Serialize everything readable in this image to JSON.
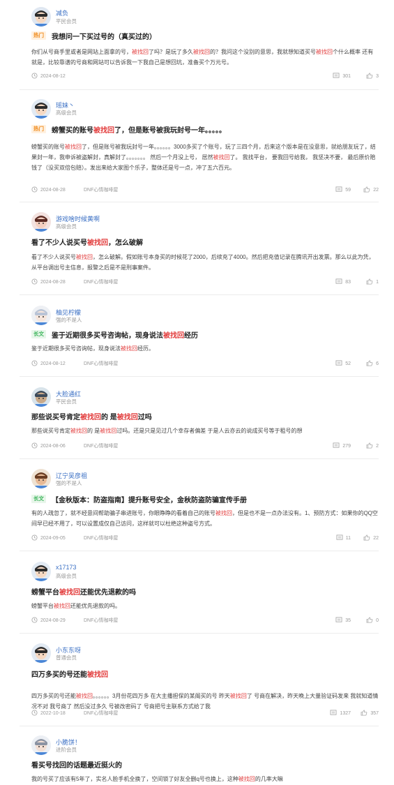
{
  "posts": [
    {
      "user": "减负",
      "level": "平民会员",
      "tag": "热门",
      "tag_type": "hot",
      "title_parts": [
        {
          "t": "我想问一下买过号的（真买过的）"
        }
      ],
      "body_parts": [
        {
          "t": "你们从号商手里或者是网站上面拿的号，"
        },
        {
          "t": "被找回",
          "hl": true
        },
        {
          "t": "了吗？是玩了多久"
        },
        {
          "t": "被找回",
          "hl": true
        },
        {
          "t": "的？我问这个没别的意思，我就想知道买号"
        },
        {
          "t": "被找回",
          "hl": true
        },
        {
          "t": "个什么概率 还有就是，比较靠谱的号商和网站可以告诉我一下我自己是想回坑，准备买个万元号。"
        }
      ],
      "date": "2024-08-12",
      "forum": "",
      "comments": "301",
      "likes": "3"
    },
    {
      "user": "瑶妹丶",
      "level": "高级会员",
      "tag": "热门",
      "tag_type": "hot",
      "title_parts": [
        {
          "t": "螃蟹买的账号"
        },
        {
          "t": "被找回",
          "hl": true
        },
        {
          "t": "了，但是账号被我玩封号一年。。。。。"
        }
      ],
      "body_parts": [
        {
          "t": "螃蟹买的账号"
        },
        {
          "t": "被找回",
          "hl": true
        },
        {
          "t": "了，但是账号被我玩封号一年。。。。。。3000多买了个账号，玩了三四个月，后来这个版本是在没意思，就给朋友玩了，结果封一年，我申诉被盗解封，真解封了。。。。。。。 然后一个月没上号， 居然"
        },
        {
          "t": "被找回",
          "hl": true
        },
        {
          "t": "了。 我找平台， 要我回号给我， 我坚决不要， 最后原价赔钱了（没买双倍包赔）。发出来给大家图个乐子，整体还是号一点，冲了五六百元。"
        }
      ],
      "date": "2024-08-28",
      "forum": "DNF心情咖啡屋",
      "comments": "59",
      "likes": "22"
    },
    {
      "user": "游戏啥时候黄啊",
      "level": "高级会员",
      "tag": "",
      "tag_type": "",
      "title_parts": [
        {
          "t": "看了不少人说买号"
        },
        {
          "t": "被找回",
          "hl": true
        },
        {
          "t": "，怎么破解"
        }
      ],
      "body_parts": [
        {
          "t": "看了不少人说买号"
        },
        {
          "t": "被找回",
          "hl": true
        },
        {
          "t": "，怎么破解。假如账号本身买的时候花了2000，后续充了4000。然后把充值记录在腾讯开出发票。那么以此为凭，从平台调出号主信息，报警之后是不是刑事案件。"
        }
      ],
      "date": "2024-08-28",
      "forum": "DNF心情咖啡屋",
      "comments": "83",
      "likes": "1"
    },
    {
      "user": "柚见柠檬",
      "level": "强的不是人",
      "tag": "长文",
      "tag_type": "long",
      "title_parts": [
        {
          "t": "鉴于近期很多买号咨询帖，现身说法"
        },
        {
          "t": "被找回",
          "hl": true
        },
        {
          "t": "经历"
        }
      ],
      "body_parts": [
        {
          "t": "鉴于近期很多买号咨询帖，现身说法"
        },
        {
          "t": "被找回",
          "hl": true
        },
        {
          "t": "经历。"
        }
      ],
      "date": "2024-08-12",
      "forum": "DNF心情咖啡屋",
      "comments": "52",
      "likes": "6"
    },
    {
      "user": "大脸通红",
      "level": "平民会员",
      "tag": "",
      "tag_type": "",
      "title_parts": [
        {
          "t": "那些说买号肯定"
        },
        {
          "t": "被找回",
          "hl": true
        },
        {
          "t": "的 是"
        },
        {
          "t": "被找回",
          "hl": true
        },
        {
          "t": "过吗"
        }
      ],
      "body_parts": [
        {
          "t": "那些说买号肯定"
        },
        {
          "t": "被找回",
          "hl": true
        },
        {
          "t": "的 是"
        },
        {
          "t": "被找回",
          "hl": true
        },
        {
          "t": "过吗。还是只是见过几个幸存者偏差 于是人云亦云的说成买号等于租号的想"
        }
      ],
      "date": "2024-08-06",
      "forum": "DNF心情咖啡屋",
      "comments": "279",
      "likes": "2"
    },
    {
      "user": "辽宁吴彦祖",
      "level": "强的不是人",
      "tag": "长文",
      "tag_type": "long",
      "title_parts": [
        {
          "t": "【金秋版本：防盗指南】提升账号安全，金秋防盗防骗宣传手册"
        }
      ],
      "body_parts": [
        {
          "t": "有的人疏忽了，就不经意间帮助骗子串进账号，你眼睁睁的看着自己的账号"
        },
        {
          "t": "被找回",
          "hl": true
        },
        {
          "t": "，但是也不是一点办法没有。1、预防方式：如果你的QQ空间早已经不用了，可以设置成仅自己访问，这样就可以杜绝这种盗号方式。"
        }
      ],
      "date": "2024-09-05",
      "forum": "DNF心情咖啡屋",
      "comments": "11",
      "likes": "22"
    },
    {
      "user": "x17173",
      "level": "高级会员",
      "tag": "",
      "tag_type": "",
      "title_parts": [
        {
          "t": "螃蟹平台"
        },
        {
          "t": "被找回",
          "hl": true
        },
        {
          "t": "还能优先退款的吗"
        }
      ],
      "body_parts": [
        {
          "t": "螃蟹平台"
        },
        {
          "t": "被找回",
          "hl": true
        },
        {
          "t": "还能优先退款的吗。"
        }
      ],
      "date": "2024-08-29",
      "forum": "DNF心情咖啡屋",
      "comments": "35",
      "likes": "0"
    },
    {
      "user": "小东东呀",
      "level": "普通会员",
      "tag": "",
      "tag_type": "",
      "title_parts": [
        {
          "t": "四万多买的号还能"
        },
        {
          "t": "被找回",
          "hl": true
        }
      ],
      "body_parts": [
        {
          "t": "四万多买的号还能"
        },
        {
          "t": "被找回",
          "hl": true
        },
        {
          "t": "。。。。。。3月份花四万多 在大主播担保的某阁买的号 昨天"
        },
        {
          "t": "被找回",
          "hl": true
        },
        {
          "t": "了 号商在解决，昨天晚上大量验证码发来 我就知道情况不对 我号商了 然后没过多久 号被改密码了 号商把号主联系方式给了我"
        }
      ],
      "date": "2022-10-18",
      "forum": "DNF心情咖啡屋",
      "comments": "1327",
      "likes": "357"
    },
    {
      "user": "小脆饼！",
      "level": "进阶会员",
      "tag": "",
      "tag_type": "",
      "title_parts": [
        {
          "t": "看买号找回的话题最近挺火的"
        }
      ],
      "body_parts": [
        {
          "t": "我的号买了应该有5年了，实名人脸手机全换了，空间锁了好友全删q号也换上，这种"
        },
        {
          "t": "被找回",
          "hl": true
        },
        {
          "t": "的几率大嘛"
        }
      ],
      "date": "",
      "forum": "",
      "comments": "",
      "likes": ""
    }
  ],
  "colors": {
    "accent_red": "#e23b3b",
    "link_blue": "#3a6fc4",
    "hot_tag": "#f08a1a",
    "long_tag": "#3bb45a"
  },
  "icons": {
    "date": "clock-icon",
    "comments": "comment-icon",
    "likes": "thumbs-up-icon"
  }
}
